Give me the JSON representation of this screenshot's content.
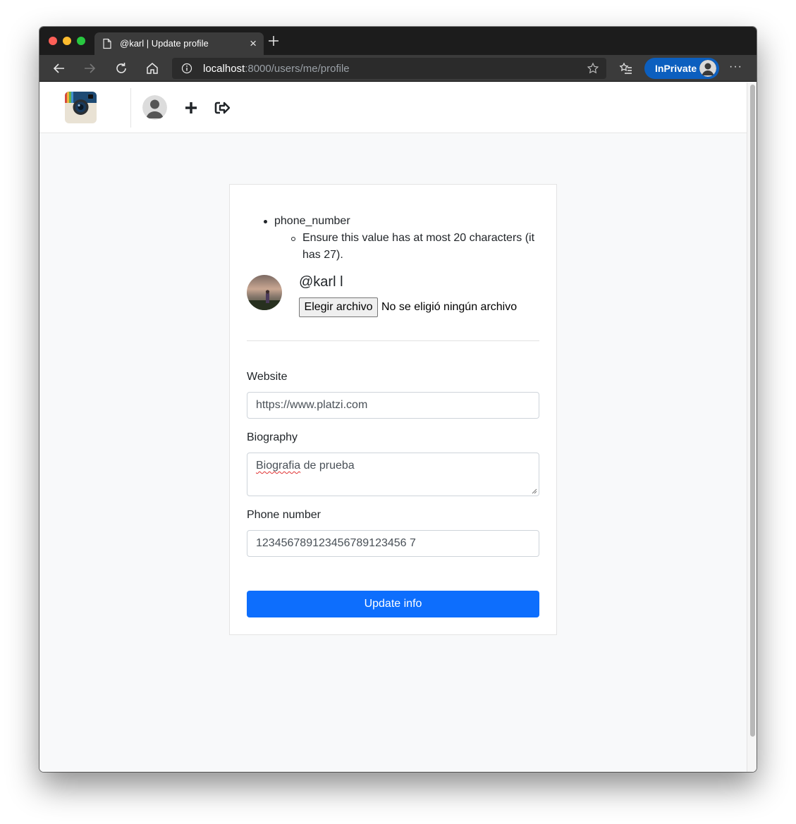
{
  "browser": {
    "tab_title": "@karl | Update profile",
    "tab_close": "×",
    "url_host": "localhost",
    "url_rest": ":8000/users/me/profile",
    "inprivate_label": "InPrivate",
    "more_label": "···"
  },
  "errors": {
    "field": "phone_number",
    "message": "Ensure this value has at most 20 characters (it has 27)."
  },
  "profile": {
    "username": "@karl l",
    "file_button": "Elegir archivo",
    "file_status": "No se eligió ningún archivo"
  },
  "form": {
    "website_label": "Website",
    "website_value": "https://www.platzi.com",
    "biography_label": "Biography",
    "biography_word1": "Biografia",
    "biography_rest": " de prueba",
    "phone_label": "Phone number",
    "phone_value": "123456789123456789123456 7",
    "submit_label": "Update info"
  },
  "colors": {
    "primary": "#0d6efd",
    "inprivate": "#0c5fbf"
  },
  "icons": [
    "document-icon",
    "new-tab-icon",
    "back-icon",
    "forward-icon",
    "refresh-icon",
    "home-icon",
    "info-icon",
    "star-icon",
    "favorites-icon",
    "instagram-logo",
    "user-icon",
    "plus-icon",
    "logout-icon"
  ]
}
